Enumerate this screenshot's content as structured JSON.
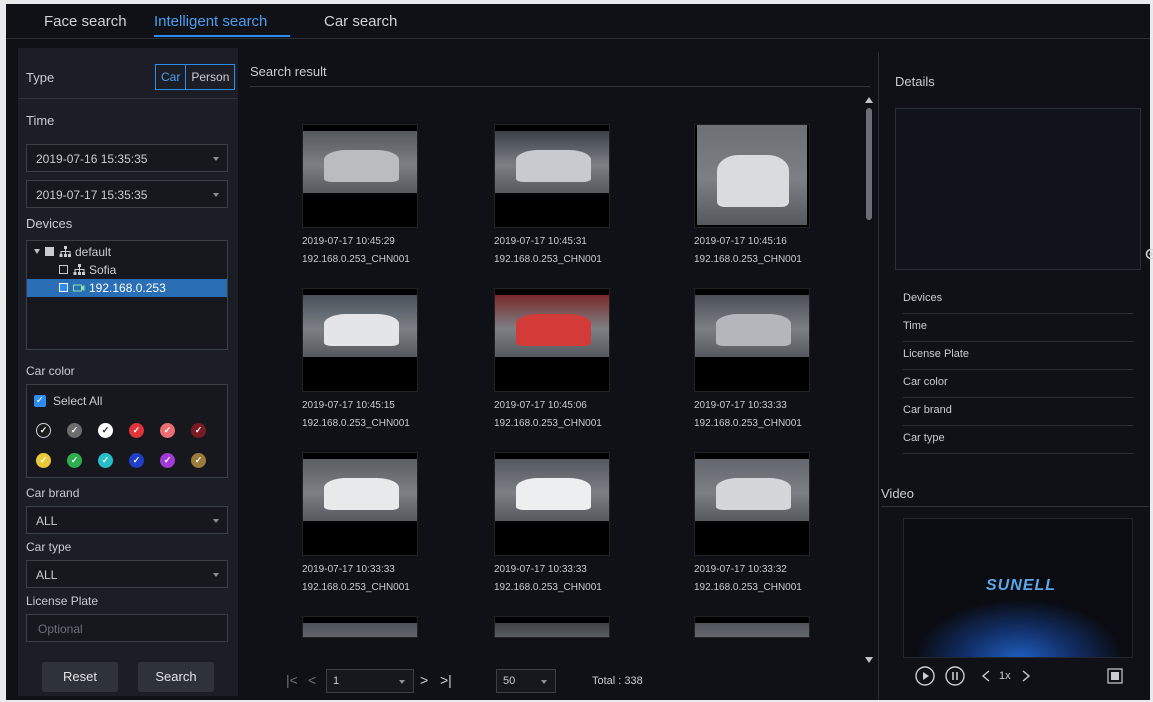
{
  "tabs": [
    "Face search",
    "Intelligent search",
    "Car search"
  ],
  "left": {
    "type_label": "Type",
    "type_options": [
      "Car",
      "Person"
    ],
    "time_label": "Time",
    "start_time": "2019-07-16 15:35:35",
    "end_time": "2019-07-17 15:35:35",
    "devices_label": "Devices",
    "tree": [
      "default",
      "Sofia",
      "192.168.0.253"
    ],
    "car_color_label": "Car color",
    "select_all": "Select All",
    "colors_row1": [
      "#1b1b1b",
      "#6d6d6d",
      "#ffffff",
      "#e0343a",
      "#ec6d74",
      "#7a1b24"
    ],
    "colors_row2": [
      "#e7c93a",
      "#2fae4e",
      "#28c0c8",
      "#1f3fc8",
      "#a23ad6",
      "#9c7a3a"
    ],
    "car_brand_label": "Car brand",
    "car_brand_value": "ALL",
    "car_type_label": "Car type",
    "car_type_value": "ALL",
    "plate_label": "License Plate",
    "plate_placeholder": "Optional",
    "reset": "Reset",
    "search": "Search"
  },
  "center": {
    "title": "Search result",
    "results": [
      {
        "time": "2019-07-17 10:45:29",
        "device": "192.168.0.253_CHN001"
      },
      {
        "time": "2019-07-17 10:45:31",
        "device": "192.168.0.253_CHN001"
      },
      {
        "time": "2019-07-17 10:45:16",
        "device": "192.168.0.253_CHN001"
      },
      {
        "time": "2019-07-17 10:45:15",
        "device": "192.168.0.253_CHN001"
      },
      {
        "time": "2019-07-17 10:45:06",
        "device": "192.168.0.253_CHN001"
      },
      {
        "time": "2019-07-17 10:33:33",
        "device": "192.168.0.253_CHN001"
      },
      {
        "time": "2019-07-17 10:33:33",
        "device": "192.168.0.253_CHN001"
      },
      {
        "time": "2019-07-17 10:33:33",
        "device": "192.168.0.253_CHN001"
      },
      {
        "time": "2019-07-17 10:33:32",
        "device": "192.168.0.253_CHN001"
      }
    ],
    "page": "1",
    "page_size": "50",
    "total": "Total : 338"
  },
  "right": {
    "details_title": "Details",
    "fields": [
      "Devices",
      "Time",
      "License Plate",
      "Car color",
      "Car brand",
      "Car type"
    ],
    "video_title": "Video",
    "logo": "SUNELL",
    "speed": "1x"
  }
}
